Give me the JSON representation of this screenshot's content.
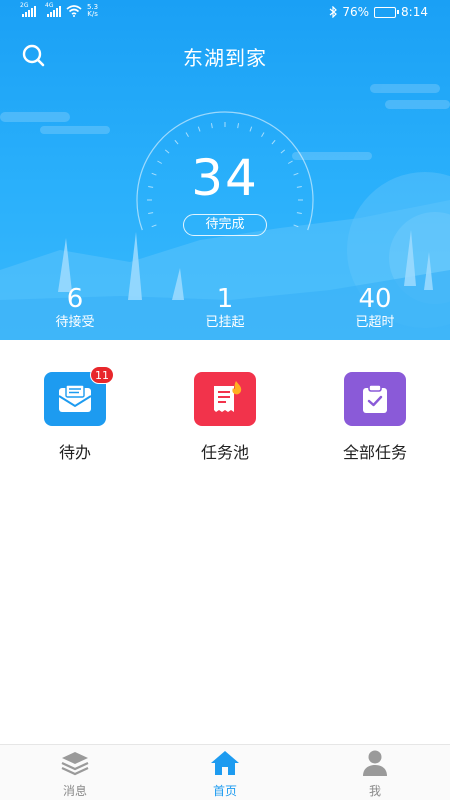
{
  "status_bar": {
    "sim1_gen": "2G",
    "sim2_gen": "4G",
    "speed_value": "5.3",
    "speed_unit": "K/s",
    "battery_text": "76%",
    "battery_level": 0.76,
    "time": "8:14"
  },
  "header": {
    "title": "东湖到家",
    "search_icon": "search-icon"
  },
  "summary": {
    "pending_count": "34",
    "pending_label": "待完成",
    "stats": [
      {
        "value": "6",
        "label": "待接受"
      },
      {
        "value": "1",
        "label": "已挂起"
      },
      {
        "value": "40",
        "label": "已超时"
      }
    ]
  },
  "features": [
    {
      "label": "待办",
      "icon": "mail-icon",
      "color": "#1d9bf0",
      "badge": "11"
    },
    {
      "label": "任务池",
      "icon": "receipt-fire-icon",
      "color": "#f2334b",
      "badge": ""
    },
    {
      "label": "全部任务",
      "icon": "clipboard-check-icon",
      "color": "#8a5ad8",
      "badge": ""
    }
  ],
  "bottom_nav": {
    "items": [
      {
        "label": "消息",
        "icon": "layers-icon",
        "active": false
      },
      {
        "label": "首页",
        "icon": "home-icon",
        "active": true
      },
      {
        "label": "我",
        "icon": "user-icon",
        "active": false
      }
    ],
    "active_color": "#1d9bf0",
    "inactive_color": "#8a8a8a"
  }
}
